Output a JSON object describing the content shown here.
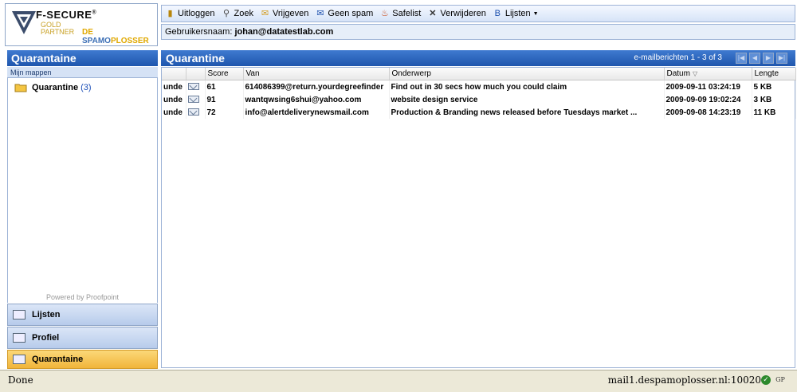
{
  "logo": {
    "brand": "F-SECURE",
    "reg": "®",
    "gold_line1": "GOLD",
    "gold_line2": "PARTNER",
    "sp_prefix": "DE ",
    "sp_mid": "SPAMO",
    "sp_suffix": "PLOSSER"
  },
  "toolbar": {
    "items": [
      {
        "label": "Uitloggen",
        "icon": "logout-icon"
      },
      {
        "label": "Zoek",
        "icon": "search-icon"
      },
      {
        "label": "Vrijgeven",
        "icon": "release-icon"
      },
      {
        "label": "Geen spam",
        "icon": "not-spam-icon"
      },
      {
        "label": "Safelist",
        "icon": "safelist-icon"
      },
      {
        "label": "Verwijderen",
        "icon": "delete-icon"
      },
      {
        "label": "Lijsten",
        "icon": "lists-icon"
      }
    ]
  },
  "user": {
    "label": "Gebruikersnaam:",
    "value": "johan@datatestlab.com"
  },
  "left": {
    "title": "Quarantaine",
    "subtitle": "Mijn mappen",
    "folder": {
      "name": "Quarantine",
      "count": "(3)"
    },
    "powered": "Powered by Proofpoint",
    "nav": [
      {
        "label": "Lijsten",
        "active": false
      },
      {
        "label": "Profiel",
        "active": false
      },
      {
        "label": "Quarantaine",
        "active": true
      }
    ]
  },
  "main": {
    "title": "Quarantine",
    "count": "e-mailberichten 1 - 3 of 3",
    "columns": [
      "",
      "",
      "Score",
      "Van",
      "Onderwerp",
      "Datum",
      "Lengte"
    ],
    "rows": [
      {
        "state": "unde",
        "score": "61",
        "from": "614086399@return.yourdegreefinder",
        "subject": "Find out in 30 secs how much you could claim",
        "date": "2009-09-11 03:24:19",
        "size": "5 KB"
      },
      {
        "state": "unde",
        "score": "91",
        "from": "wantqwsing6shui@yahoo.com",
        "subject": "website design service",
        "date": "2009-09-09 19:02:24",
        "size": "3 KB"
      },
      {
        "state": "unde",
        "score": "72",
        "from": "info@alertdeliverynewsmail.com",
        "subject": "Production & Branding news released before Tuesdays market ...",
        "date": "2009-09-08 14:23:19",
        "size": "11 KB"
      }
    ]
  },
  "status": {
    "left": "Done",
    "right": "mail1.despamoplosser.nl:10020"
  }
}
